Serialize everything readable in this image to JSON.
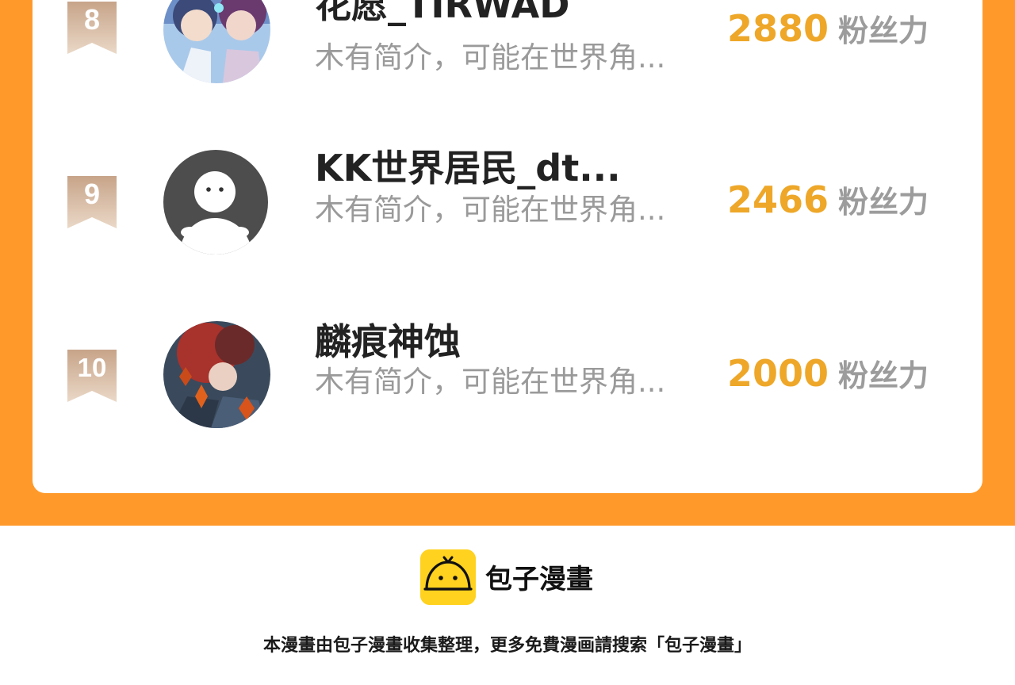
{
  "ranking": {
    "entries": [
      {
        "rank": "8",
        "name": "花愿_TIRWAD",
        "bio": "木有简介，可能在世界角...",
        "score": "2880",
        "score_unit": "粉丝力",
        "avatar": "anime-couple-avatar"
      },
      {
        "rank": "9",
        "name": "KK世界居民_dt...",
        "bio": "木有简介，可能在世界角...",
        "score": "2466",
        "score_unit": "粉丝力",
        "avatar": "default-ghost-avatar"
      },
      {
        "rank": "10",
        "name": "麟痕神蚀",
        "bio": "木有简介，可能在世界角...",
        "score": "2000",
        "score_unit": "粉丝力",
        "avatar": "red-hair-anime-avatar"
      }
    ]
  },
  "footer": {
    "brand_name": "包子漫畫",
    "note": "本漫畫由包子漫畫收集整理，更多免費漫画請搜索「包子漫畫」"
  },
  "colors": {
    "orange_bg": "#ff9a2a",
    "score": "#eea728",
    "ribbon_top": "#c9a88c",
    "ribbon_bottom": "#e8d4c2",
    "logo_yellow": "#ffd21f"
  }
}
